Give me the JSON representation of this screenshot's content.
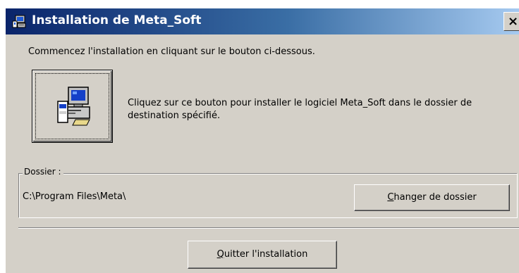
{
  "window": {
    "title": "Installation de Meta_Soft",
    "close_glyph": "×"
  },
  "instructions": "Commencez l'installation en cliquant sur le bouton ci-dessous.",
  "install_button": {
    "icon": "computer-install-icon",
    "description": "Cliquez sur ce bouton pour installer le logiciel Meta_Soft dans le dossier de destination spécifié."
  },
  "folder": {
    "legend": "Dossier :",
    "path": "C:\\Program Files\\Meta\\",
    "change_button_mnemonic": "C",
    "change_button_rest": "hanger de dossier"
  },
  "quit_button": {
    "mnemonic": "Q",
    "rest": "uitter l'installation"
  },
  "colors": {
    "title_bar_start": "#0a246a",
    "title_bar_end": "#a6caf0",
    "dialog_face": "#d4d0c8"
  }
}
